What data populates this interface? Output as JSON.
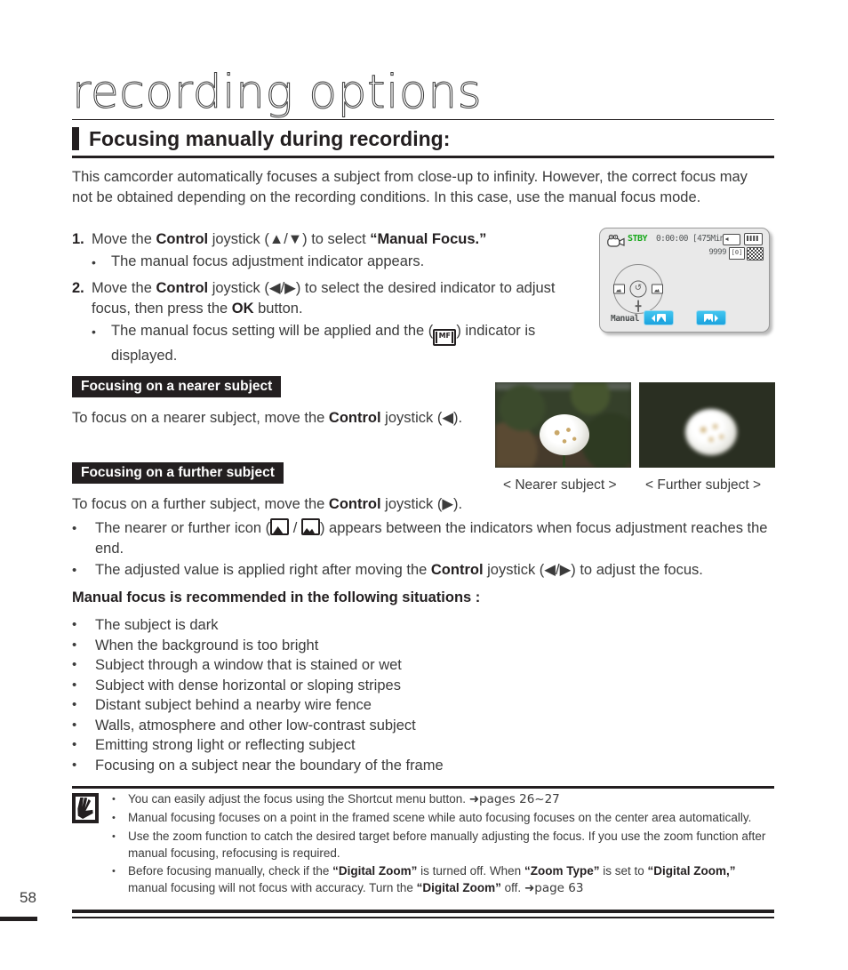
{
  "chapter": {
    "title": "recording options"
  },
  "section": {
    "heading": "Focusing manually during recording:"
  },
  "intro": "This camcorder automatically focuses a subject from close-up to infinity. However, the correct focus may not be obtained depending on the recording conditions. In this case, use the manual focus mode.",
  "steps": [
    {
      "num": "1.",
      "text_parts": [
        "Move the ",
        "Control",
        " joystick (▲/▼) to select ",
        "“Manual Focus.”"
      ],
      "sub": [
        "The manual focus adjustment indicator appears."
      ]
    },
    {
      "num": "2.",
      "text_parts": [
        "Move the ",
        "Control",
        " joystick (◀/▶) to select the desired indicator to adjust focus, then press the ",
        "OK",
        " button."
      ],
      "sub": [
        "The manual focus setting will be applied and the ( ) indicator is displayed."
      ]
    }
  ],
  "lcd": {
    "camera_icon": "camcorder-icon",
    "status": "STBY",
    "timecode": "0:00:00 [475Min]",
    "photo_count": "9999",
    "mode_label": "Manual Focus",
    "card_icon": "memory-card-icon",
    "battery_icon": "battery-icon",
    "square_icon_1": "photo-size-icon",
    "square_icon_2": "quality-icon",
    "dial_center": "↺",
    "chip_left": "nearer-focus-chip",
    "chip_right": "further-focus-chip"
  },
  "near": {
    "label": "Focusing on a nearer subject",
    "paragraph_parts": [
      "To focus on a nearer subject, move the ",
      "Control",
      " joystick (◀)."
    ],
    "caption": "< Nearer subject >"
  },
  "far": {
    "label": "Focusing on a further subject",
    "paragraph_parts": [
      "To focus on a further subject, move the ",
      "Control",
      " joystick (▶)."
    ],
    "caption": "< Further subject >"
  },
  "icon_bullets": [
    {
      "pre": "The nearer or further icon (",
      "mid": " / ",
      "post": ") appears between the indicators when focus adjustment reaches the end."
    },
    {
      "pre": "The adjusted value is applied right after moving the ",
      "bold": "Control",
      "post": " joystick (◀/▶) to adjust the focus."
    }
  ],
  "recommend_title": "Manual focus is recommended in the following situations :",
  "situations": [
    "The subject is dark",
    "When the background is too bright",
    "Subject through a window that is stained or wet",
    "Subject with dense horizontal or sloping stripes",
    "Distant subject behind a nearby wire fence",
    "Walls, atmosphere and other low-contrast subject",
    "Emitting strong light or reflecting subject",
    "Focusing on a subject near the boundary of the frame"
  ],
  "notes": [
    {
      "plain": "You can easily adjust the focus using the Shortcut menu button. ",
      "ref": "➜pages 26~27"
    },
    {
      "plain": "Manual focusing focuses on a point in the framed scene while auto focusing focuses on the center area automatically.",
      "ref": ""
    },
    {
      "plain": "Use the zoom function to catch the desired target before manually adjusting the focus. If you use the zoom function after manual focusing, refocusing is required.",
      "ref": ""
    },
    {
      "p1": "Before focusing manually, check if the ",
      "b1": "“Digital Zoom”",
      "p2": " is turned off. When ",
      "b2": "“Zoom Type”",
      "p3": " is set to ",
      "b3": "“Digital Zoom,”",
      "p4": " manual focusing will not focus with accuracy. Turn the ",
      "b4": "“Digital Zoom”",
      "p5": " off. ",
      "ref": "➜page 63"
    }
  ],
  "footer": {
    "page_number": "58"
  },
  "colors": {
    "ink": "#231f20",
    "body_text": "#3b3b3b",
    "lcd_bg": "#e9e9e9",
    "stby_green": "#17a81a",
    "chip_blue": "#1ba3de"
  }
}
